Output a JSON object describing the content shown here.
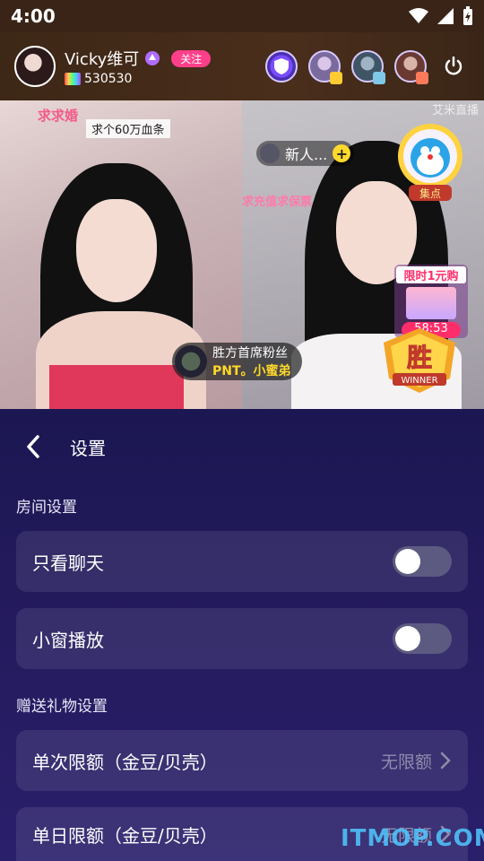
{
  "status_bar": {
    "time": "4:00"
  },
  "header": {
    "anchor_name": "Vicky维可",
    "follow_label": "关注",
    "anchor_id": "530530"
  },
  "video": {
    "left_overlay_1": "求求婚",
    "left_overlay_2": "求个60万血条",
    "right_overlay_1": "求充值求保票",
    "right_overlay_tiny": "艾米直播",
    "guest_name": "新人...",
    "guest_plus": "+",
    "fan_line1": "胜方首席粉丝",
    "fan_line2": "PNT。小蜜弟",
    "badge_label": "集点",
    "promo_title": "限时1元购",
    "promo_timer": "58:53",
    "winner_char": "胜",
    "winner_label": "WINNER"
  },
  "settings": {
    "title": "设置",
    "room_section": "房间设置",
    "chat_only_label": "只看聊天",
    "chat_only_on": false,
    "mini_window_label": "小窗播放",
    "mini_window_on": false,
    "gift_section": "赠送礼物设置",
    "single_limit_label": "单次限额（金豆/贝壳）",
    "single_limit_value": "无限额",
    "daily_limit_label": "单日限额（金豆/贝壳）",
    "daily_limit_value": "无限额"
  },
  "watermark": "ITMOP.COM",
  "colors": {
    "accent_pink": "#ff3f8a",
    "panel_bg": "#1b1752",
    "toggle_off": "#5c5a80"
  }
}
